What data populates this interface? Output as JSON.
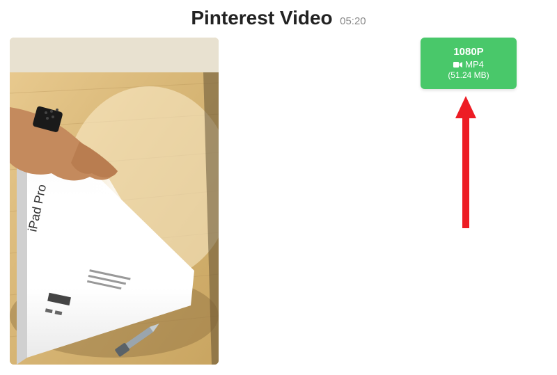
{
  "header": {
    "title": "Pinterest Video",
    "duration": "05:20"
  },
  "download": {
    "resolution": "1080P",
    "format": "MP4",
    "size": "(51.24 MB)"
  },
  "thumbnail": {
    "product_text": "iPad Pro"
  },
  "arrow": {
    "color": "#ed1c24"
  }
}
